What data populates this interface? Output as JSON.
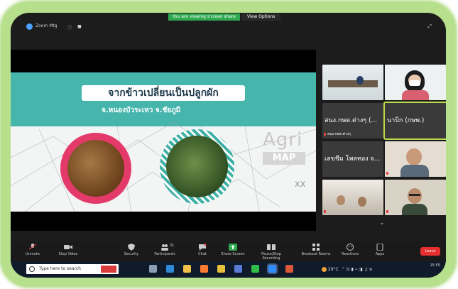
{
  "banner": {
    "message": "You are viewing s'creen share",
    "options_label": "View Options"
  },
  "window": {
    "title": "Zoom Mtg",
    "icons": [
      "zoom-logo-icon",
      "info-icon",
      "lock-icon",
      "fullscreen-icon"
    ]
  },
  "slide": {
    "headline": "จากข้าวเปลี่ยนเป็นปลูกผัก",
    "location": "จ.หนองบัวระเหว จ.ชัยภูมิ",
    "brand_word": "Agri",
    "brand_box": "MAP",
    "brand_tail": "xx",
    "colors": {
      "teal": "#46b5ac",
      "pink": "#e33a6a"
    }
  },
  "gallery": {
    "tiles": [
      {
        "name": "",
        "big_name": "",
        "muted": false,
        "active": false,
        "scene": "office-desk"
      },
      {
        "name": "",
        "big_name": "",
        "muted": false,
        "active": false,
        "scene": "woman-mask"
      },
      {
        "name": "สนง.กษต.ต่างๆ",
        "big_name": "สนง.กษต.ต่างๆ (...",
        "muted": true,
        "active": false,
        "scene": "name-only"
      },
      {
        "name": "",
        "big_name": "นาบิก (กษพ.)",
        "muted": false,
        "active": true,
        "scene": "name-only"
      },
      {
        "name": "",
        "big_name": "เลขชีม โพลทอง จ...",
        "muted": false,
        "active": false,
        "scene": "name-only"
      },
      {
        "name": "",
        "big_name": "",
        "muted": true,
        "active": false,
        "scene": "man-portrait"
      },
      {
        "name": "",
        "big_name": "",
        "muted": true,
        "active": false,
        "scene": "room-group"
      },
      {
        "name": "",
        "big_name": "",
        "muted": true,
        "active": false,
        "scene": "man-glasses"
      }
    ],
    "more_label": "⌄"
  },
  "toolbar": {
    "items": [
      {
        "label": "Unmute",
        "icon": "microphone-icon"
      },
      {
        "label": "Stop Video",
        "icon": "video-camera-icon"
      },
      {
        "label": "Security",
        "icon": "shield-icon"
      },
      {
        "label": "Participants",
        "icon": "participants-icon",
        "badge": "31"
      },
      {
        "label": "Chat",
        "icon": "chat-icon"
      },
      {
        "label": "Share Screen",
        "icon": "share-screen-icon"
      },
      {
        "label": "Pause/Stop Recording",
        "icon": "record-icon"
      },
      {
        "label": "Breakout Rooms",
        "icon": "breakout-rooms-icon"
      },
      {
        "label": "Reactions",
        "icon": "reactions-icon"
      },
      {
        "label": "Apps",
        "icon": "apps-icon"
      }
    ],
    "leave_label": "Leave",
    "colors": {
      "share": "#2fa84f",
      "leave": "#e5302f"
    }
  },
  "taskbar": {
    "search_placeholder": "Type here to search",
    "apps": [
      "task-view-icon",
      "edge-icon",
      "folder-icon",
      "firefox-icon",
      "chrome-icon",
      "store-icon",
      "line-icon",
      "zoom-icon",
      "app-icon"
    ],
    "weather": "29°C",
    "time": "15:55",
    "date": ""
  }
}
